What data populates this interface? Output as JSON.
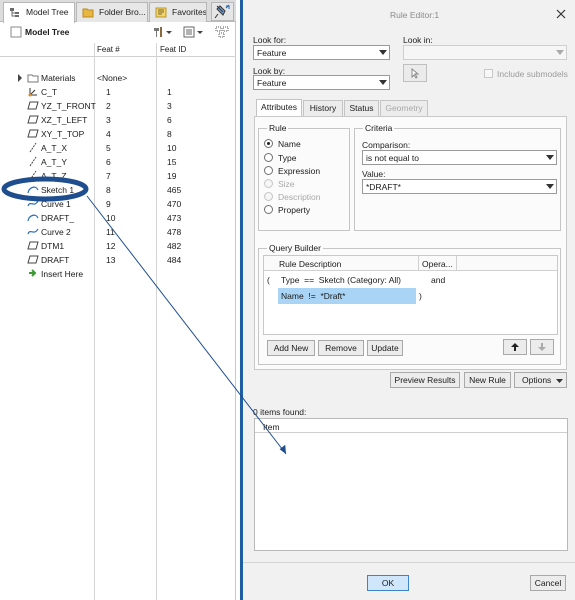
{
  "tree_panel": {
    "tabs": [
      {
        "label": "Model Tree",
        "icon": "model-tree-icon"
      },
      {
        "label": "Folder Bro...",
        "icon": "folder-icon"
      },
      {
        "label": "Favorites",
        "icon": "favorites-icon"
      }
    ],
    "title": "Model Tree",
    "columns": {
      "feat_num": "Feat #",
      "feat_id": "Feat ID"
    },
    "rows": [
      {
        "name": "Materials",
        "feat": "<None>",
        "fid": "",
        "icon": "materials-folder-icon"
      },
      {
        "name": "C_T",
        "feat": "1",
        "fid": "1",
        "icon": "coordinate-system-icon"
      },
      {
        "name": "YZ_T_FRONT",
        "feat": "2",
        "fid": "3",
        "icon": "datum-plane-icon"
      },
      {
        "name": "XZ_T_LEFT",
        "feat": "3",
        "fid": "6",
        "icon": "datum-plane-icon"
      },
      {
        "name": "XY_T_TOP",
        "feat": "4",
        "fid": "8",
        "icon": "datum-plane-icon"
      },
      {
        "name": "A_T_X",
        "feat": "5",
        "fid": "10",
        "icon": "datum-axis-icon"
      },
      {
        "name": "A_T_Y",
        "feat": "6",
        "fid": "15",
        "icon": "datum-axis-icon"
      },
      {
        "name": "A_T_Z",
        "feat": "7",
        "fid": "19",
        "icon": "datum-axis-icon"
      },
      {
        "name": "Sketch 1",
        "feat": "8",
        "fid": "465",
        "icon": "sketch-icon"
      },
      {
        "name": "Curve 1",
        "feat": "9",
        "fid": "470",
        "icon": "curve-icon"
      },
      {
        "name": "DRAFT_",
        "feat": "10",
        "fid": "473",
        "icon": "sketch-icon"
      },
      {
        "name": "Curve 2",
        "feat": "11",
        "fid": "478",
        "icon": "curve-icon"
      },
      {
        "name": "DTM1",
        "feat": "12",
        "fid": "482",
        "icon": "datum-plane-icon"
      },
      {
        "name": "DRAFT",
        "feat": "13",
        "fid": "484",
        "icon": "datum-plane-icon"
      },
      {
        "name": "Insert Here",
        "feat": "",
        "fid": "",
        "icon": "insert-here-arrow-icon"
      }
    ]
  },
  "dialog": {
    "title": "Rule Editor:1",
    "look_for_label": "Look for:",
    "look_for_value": "Feature",
    "look_by_label": "Look by:",
    "look_by_value": "Feature",
    "look_in_label": "Look in:",
    "look_in_value": "",
    "include_submodels": "Include submodels",
    "tabs": [
      "Attributes",
      "History",
      "Status",
      "Geometry"
    ],
    "rule": {
      "title": "Rule",
      "options": [
        "Name",
        "Type",
        "Expression",
        "Size",
        "Description",
        "Property"
      ],
      "selected": "Name",
      "disabled": [
        "Size",
        "Description"
      ]
    },
    "criteria": {
      "title": "Criteria",
      "comparison_label": "Comparison:",
      "comparison_value": "is not equal to",
      "value_label": "Value:",
      "value_value": "*DRAFT*"
    },
    "query_builder": {
      "title": "Query Builder",
      "col_desc": "Rule Description",
      "col_oper": "Opera...",
      "rows": [
        {
          "open": "(",
          "text": "Type  ==  Sketch (Category: All)",
          "operator": "and",
          "close": ""
        },
        {
          "open": "",
          "text": "Name  !=  *Draft*",
          "operator": "",
          "close": ")"
        }
      ]
    },
    "buttons": {
      "add_new": "Add New",
      "remove": "Remove",
      "update": "Update",
      "preview": "Preview Results",
      "new_rule": "New Rule",
      "options": "Options",
      "ok": "OK",
      "cancel": "Cancel"
    },
    "results_count": "0 items found:",
    "results_col": "Item"
  },
  "colors": {
    "highlight": "#a9d4f5",
    "annotation": "#1f4e8f",
    "dialog_border": "#1e5fa3"
  }
}
